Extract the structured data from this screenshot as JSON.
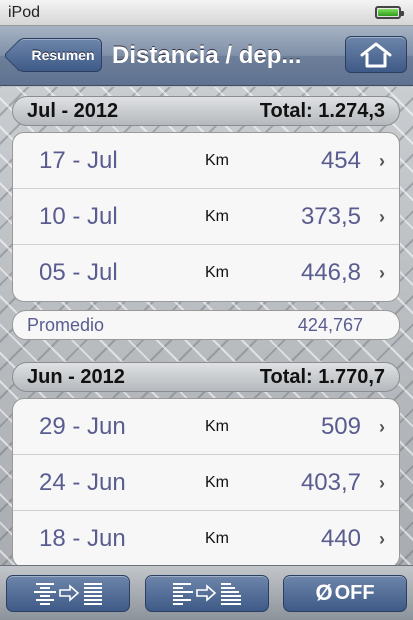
{
  "status_bar": {
    "carrier": "iPod",
    "battery_icon": "battery-full-icon"
  },
  "nav": {
    "back_label": "Resumen",
    "title": "Distancia / dep...",
    "home_icon": "home-icon"
  },
  "sections": [
    {
      "month": "Jul - 2012",
      "total": "Total: 1.274,3",
      "rows": [
        {
          "date": "17 - Jul",
          "unit": "Km",
          "value": "454"
        },
        {
          "date": "10 - Jul",
          "unit": "Km",
          "value": "373,5"
        },
        {
          "date": "05 - Jul",
          "unit": "Km",
          "value": "446,8"
        }
      ],
      "average_label": "Promedio",
      "average_value": "424,767"
    },
    {
      "month": "Jun - 2012",
      "total": "Total: 1.770,7",
      "rows": [
        {
          "date": "29 - Jun",
          "unit": "Km",
          "value": "509"
        },
        {
          "date": "24 - Jun",
          "unit": "Km",
          "value": "403,7"
        },
        {
          "date": "18 - Jun",
          "unit": "Km",
          "value": "440"
        }
      ]
    }
  ],
  "toolbar": {
    "expand_icon": "align-expand-icon",
    "collapse_icon": "align-collapse-icon",
    "off_symbol": "Ø",
    "off_label": "OFF"
  },
  "colors": {
    "value_text": "#5a5c8f",
    "button_blue": "#3e5a87"
  }
}
